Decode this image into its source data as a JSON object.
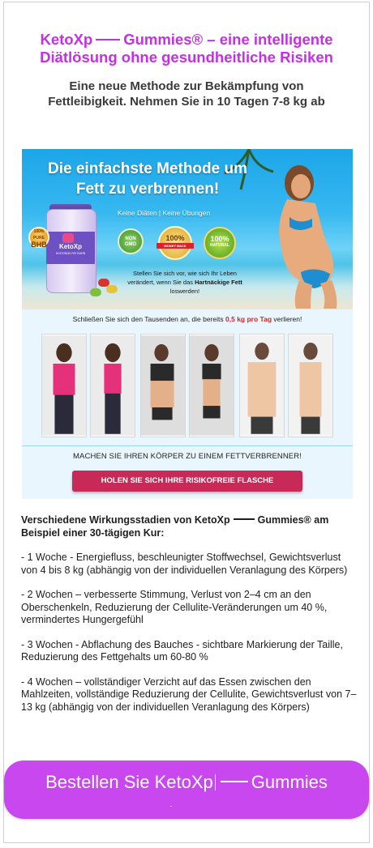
{
  "headline": {
    "brand": "KetoXp",
    "rest": "Gummies® – eine intelligente Diätlösung ohne gesundheitliche Risiken"
  },
  "subheadline": "Eine neue Methode zur Bekämpfung von Fettleibigkeit. Nehmen Sie in 10 Tagen 7-8 kg ab",
  "banner": {
    "title": "Die einfachste Methode um Fett zu verbrennen!",
    "subtitle": "Keine Diäten | Keine Übungen",
    "jar_name": "KetoXp",
    "jar_sub": "SOOTHING FAT BURN",
    "badge_bhb_top": "100% PURE",
    "badge_bhb": "BHB",
    "seal_1": "NON GMO",
    "seal_2_top": "100%",
    "seal_2_ribbon": "MONEY BACK",
    "seal_2_bottom": "GUARANTEE",
    "seal_3_top": "100%",
    "seal_3_mid": "NATURAL",
    "seal_3_bottom": "INGREDIENTS",
    "hero_text_1": "Stellen Sie sich vor, wie sich Ihr Leben verändert, wenn Sie das",
    "hero_text_bold": "Hartnäckige Fett",
    "hero_text_2": "loswerden!",
    "join_text_1": "Schließen Sie sich den Tausenden an, die bereits",
    "join_highlight": "0,5 kg pro Tag",
    "join_text_2": "verlieren!",
    "tagline": "MACHEN SIE IHREN KÖRPER ZU EINEM FETTVERBRENNER!",
    "cta": "HOLEN SIE SICH IHRE RISIKOFREIE FLASCHE"
  },
  "stages": {
    "intro_1": "Verschiedene Wirkungsstadien von KetoXp",
    "intro_2": "Gummies® am Beispiel einer 30-tägigen Kur:",
    "items": [
      "- 1 Woche - Energiefluss, beschleunigter Stoffwechsel, Gewichtsverlust von 4 bis 8 kg (abhängig von der individuellen Veranlagung des Körpers)",
      "- 2 Wochen – verbesserte Stimmung, Verlust von 2–4 cm an den Oberschenkeln, Reduzierung der Cellulite-Veränderungen um 40 %, vermindertes Hungergefühl",
      "- 3 Wochen - Abflachung des Bauches - sichtbare Markierung der Taille, Reduzierung des Fettgehalts um 60-80 %",
      "- 4 Wochen – vollständiger Verzicht auf das Essen zwischen den Mahlzeiten, vollständige Reduzierung der Cellulite, Gewichtsverlust von 7–13 kg (abhängig von der individuellen Veranlagung des Körpers)"
    ]
  },
  "order_button": {
    "label_1": "Bestellen Sie KetoXp",
    "label_2": "Gummies"
  },
  "colors": {
    "accent": "#c431e4",
    "button": "#c947ef",
    "cta_red": "#c72a57",
    "highlight_red": "#d8232a"
  }
}
